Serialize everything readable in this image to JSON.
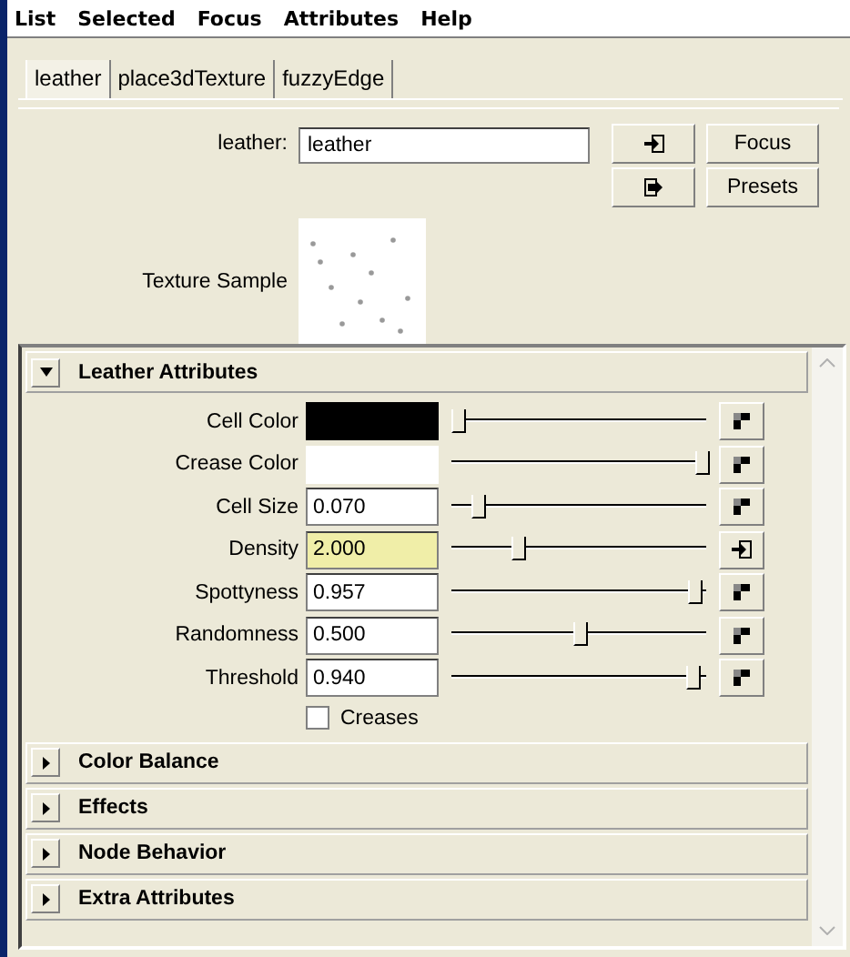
{
  "menu": [
    "List",
    "Selected",
    "Focus",
    "Attributes",
    "Help"
  ],
  "tabs": [
    {
      "label": "leather",
      "selected": true
    },
    {
      "label": "place3dTexture",
      "selected": false
    },
    {
      "label": "fuzzyEdge",
      "selected": false
    }
  ],
  "node": {
    "label": "leather:",
    "value": "leather",
    "buttons": [
      "Focus",
      "Presets"
    ],
    "sample_label": "Texture Sample"
  },
  "sections": [
    {
      "title": "Leather Attributes",
      "expanded": true,
      "attributes": [
        {
          "kind": "color",
          "label": "Cell Color",
          "color": "#000000",
          "level": 0.02,
          "connected": false
        },
        {
          "kind": "color",
          "label": "Crease Color",
          "color": "#ffffff",
          "level": 0.98,
          "connected": false
        },
        {
          "kind": "number",
          "label": "Cell Size",
          "value": "0.070",
          "level": 0.1,
          "highlighted": false,
          "connected": false
        },
        {
          "kind": "number",
          "label": "Density",
          "value": "2.000",
          "level": 0.26,
          "highlighted": true,
          "connected": true
        },
        {
          "kind": "number",
          "label": "Spottyness",
          "value": "0.957",
          "level": 0.95,
          "highlighted": false,
          "connected": false
        },
        {
          "kind": "number",
          "label": "Randomness",
          "value": "0.500",
          "level": 0.5,
          "highlighted": false,
          "connected": false
        },
        {
          "kind": "number",
          "label": "Threshold",
          "value": "0.940",
          "level": 0.94,
          "highlighted": false,
          "connected": false
        }
      ],
      "checkbox": {
        "label": "Creases",
        "checked": false
      }
    },
    {
      "title": "Color Balance",
      "expanded": false
    },
    {
      "title": "Effects",
      "expanded": false
    },
    {
      "title": "Node Behavior",
      "expanded": false
    },
    {
      "title": "Extra Attributes",
      "expanded": false
    }
  ]
}
